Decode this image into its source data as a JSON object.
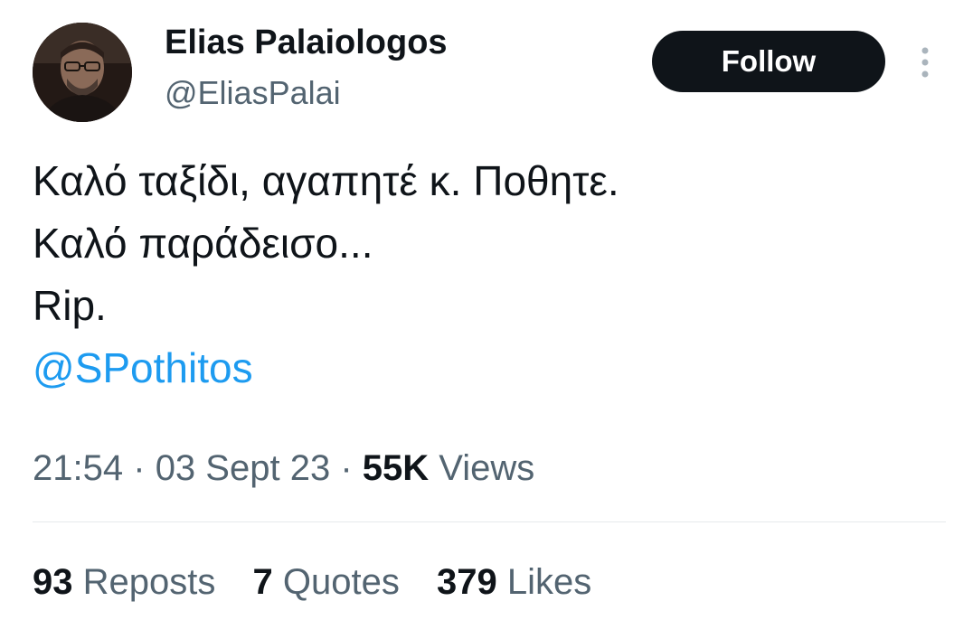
{
  "author": {
    "display_name": "Elias Palaiologos",
    "handle": "@EliasPalai"
  },
  "actions": {
    "follow_label": "Follow",
    "more_icon": "more-vertical-icon"
  },
  "tweet": {
    "lines": [
      "Καλό ταξίδι,  αγαπητέ κ. Ποθητε.",
      "Καλό παράδεισο...",
      "Rip."
    ],
    "mention": "@SPothitos"
  },
  "meta": {
    "time": "21:54",
    "separator": "·",
    "date": "03 Sept 23",
    "views_count": "55K",
    "views_label": "Views"
  },
  "stats": {
    "reposts_count": "93",
    "reposts_label": "Reposts",
    "quotes_count": "7",
    "quotes_label": "Quotes",
    "likes_count": "379",
    "likes_label": "Likes"
  },
  "colors": {
    "text": "#0f1419",
    "secondary": "#536471",
    "link": "#1d9bf0",
    "button_bg": "#0f1419",
    "button_text": "#ffffff",
    "divider": "#e6e9ec"
  }
}
